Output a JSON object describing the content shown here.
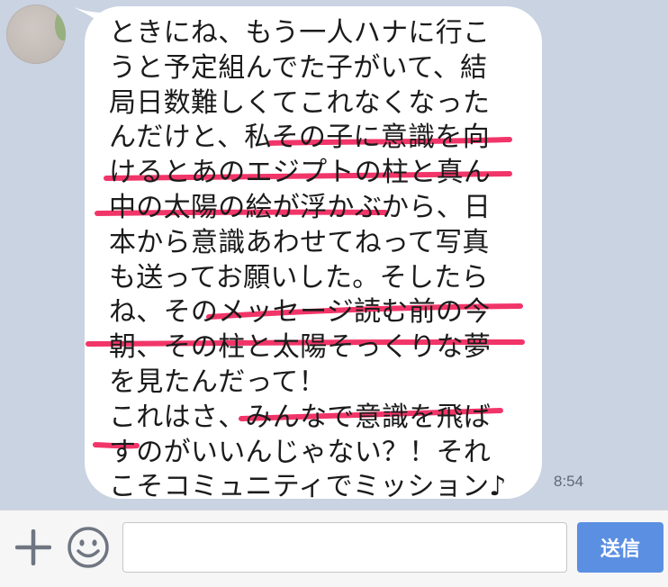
{
  "message": {
    "lines": [
      "ときにね、もう一人ハナに行こ",
      "うと予定組んでた子がいて、結",
      "局日数難しくてこれなくなった",
      "んだけと、私その子に意識を向",
      "けるとあのエジプトの柱と真ん",
      "中の太陽の絵が浮かぶから、日",
      "本から意識あわせてねって写真",
      "も送ってお願いした。そしたら",
      "ね、そのメッセージ読む前の今",
      "朝、その柱と太陽そっくりな夢",
      "を見たんだって！",
      "これはさ、みんなで意識を飛ば",
      "すのがいいんじゃない？！それ",
      "こそコミュニティでミッション♪"
    ],
    "timestamp": "8:54",
    "underline_color": "#f0245c"
  },
  "input_bar": {
    "input_value": "",
    "input_placeholder": "",
    "send_label": "送信",
    "send_color": "#5b8fe2"
  },
  "icons": {
    "plus": "plus-icon",
    "emoji": "emoji-icon"
  }
}
